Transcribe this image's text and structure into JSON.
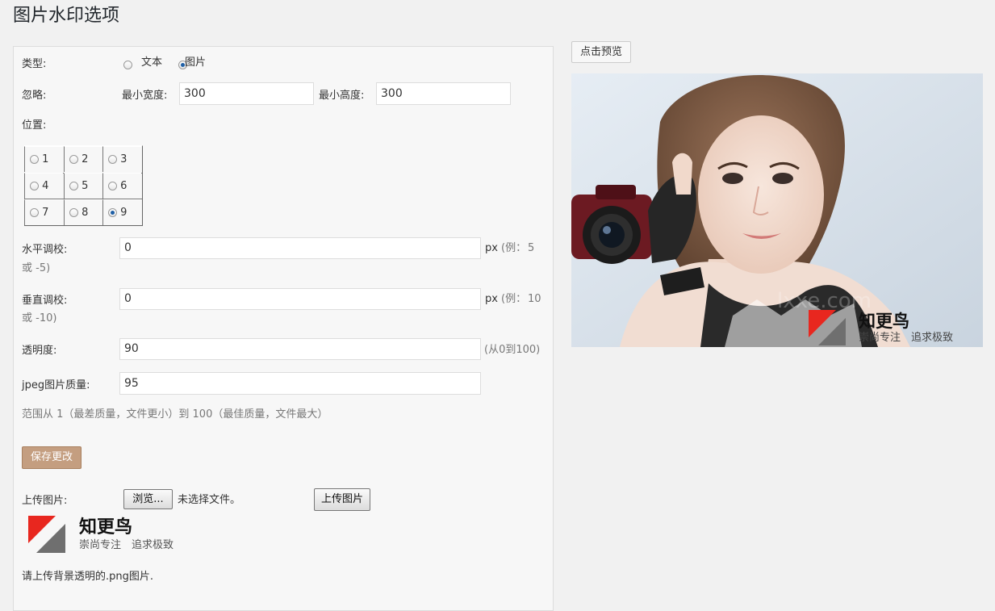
{
  "page": {
    "title": "图片水印选项"
  },
  "form": {
    "type": {
      "label": "类型:",
      "options": [
        "文本",
        "图片"
      ],
      "selected": "图片"
    },
    "ignore": {
      "label": "忽略:",
      "min_width_label": "最小宽度:",
      "min_width_value": "300",
      "min_height_label": "最小高度:",
      "min_height_value": "300"
    },
    "position": {
      "label": "位置:",
      "cells": [
        "1",
        "2",
        "3",
        "4",
        "5",
        "6",
        "7",
        "8",
        "9"
      ],
      "selected": "9"
    },
    "horizontal": {
      "label": "水平调校:",
      "value": "0",
      "unit": "px",
      "hint_a": "(例：",
      "hint_b": "5",
      "hint_c": "或 -5)"
    },
    "vertical": {
      "label": "垂直调校:",
      "value": "0",
      "unit": "px",
      "hint_a": "(例：",
      "hint_b": "10",
      "hint_c": "或 -10)"
    },
    "opacity": {
      "label": "透明度:",
      "value": "90",
      "hint": "(从0到100)"
    },
    "jpeg": {
      "label": "jpeg图片质量:",
      "value": "95",
      "hint": "范围从 1（最差质量，文件更小）到 100（最佳质量，文件最大）"
    },
    "save_label": "保存更改",
    "upload": {
      "label": "上传图片:",
      "browse_label": "浏览...",
      "no_file_text": "未选择文件。",
      "upload_button": "上传图片",
      "note": "请上传背景透明的.png图片."
    }
  },
  "logo": {
    "name": "知更鸟",
    "slogan": "崇尚专注　追求极致",
    "red": "#e8271f",
    "gray": "#6f6f6f"
  },
  "preview": {
    "button_label": "点击预览"
  }
}
